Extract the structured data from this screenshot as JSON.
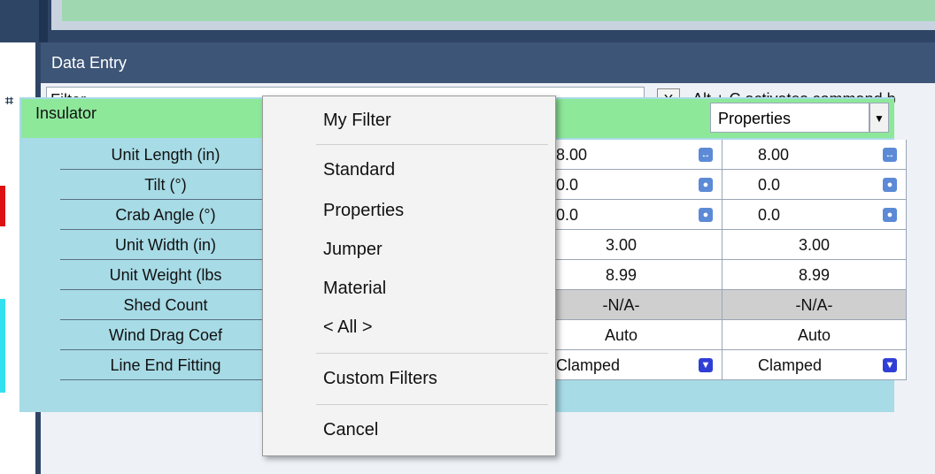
{
  "panel": {
    "title": "Data Entry"
  },
  "filter": {
    "value": "Filter",
    "clear_label": "X",
    "hint": "Alt + C activates command b"
  },
  "grid": {
    "title": "Insulator",
    "properties_select": "Properties",
    "rows": [
      {
        "label": "Unit Length (in)",
        "c1": "8.00",
        "c2": "8.00",
        "icon": "double-arrow-icon"
      },
      {
        "label": "Tilt (°)",
        "c1": "0.0",
        "c2": "0.0",
        "icon": "circle-icon"
      },
      {
        "label": "Crab Angle (°)",
        "c1": "0.0",
        "c2": "0.0",
        "icon": "circle-icon"
      },
      {
        "label": "Unit Width (in)",
        "c1": "3.00",
        "c2": "3.00"
      },
      {
        "label": "Unit Weight (lbs",
        "c1": "8.99",
        "c2": "8.99"
      },
      {
        "label": "Shed Count",
        "c1": "-N/A-",
        "c2": "-N/A-"
      },
      {
        "label": "Wind Drag Coef",
        "c1": "Auto",
        "c2": "Auto"
      },
      {
        "label": "Line End Fitting",
        "c1": "Clamped",
        "c2": "Clamped",
        "icon": "dropdown-icon"
      }
    ]
  },
  "menu": {
    "items": [
      "My Filter",
      "Standard",
      "Properties",
      "Jumper",
      "Material",
      "< All >",
      "Custom Filters",
      "Cancel"
    ]
  },
  "colors": {
    "header_green": "#8ee89a",
    "grid_blue": "#a7dbe6",
    "title_bar": "#3d5577"
  }
}
